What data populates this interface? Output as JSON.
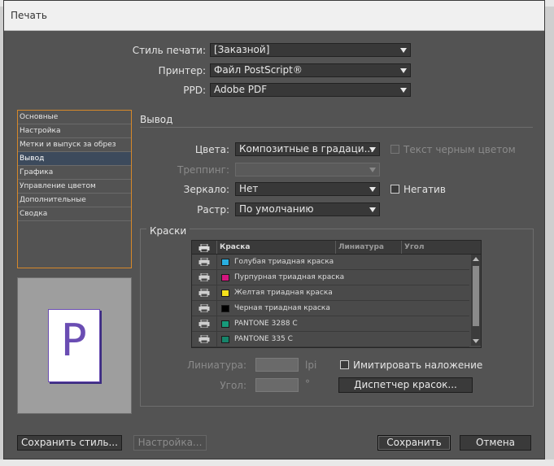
{
  "window": {
    "title": "Печать"
  },
  "top": {
    "style_label": "Стиль печати:",
    "style_value": "[Заказной]",
    "printer_label": "Принтер:",
    "printer_value": "Файл PostScript®",
    "ppd_label": "PPD:",
    "ppd_value": "Adobe PDF"
  },
  "sidebar": {
    "items": [
      {
        "label": "Основные"
      },
      {
        "label": "Настройка"
      },
      {
        "label": "Метки и выпуск за обрез"
      },
      {
        "label": "Вывод"
      },
      {
        "label": "Графика"
      },
      {
        "label": "Управление цветом"
      },
      {
        "label": "Дополнительные"
      },
      {
        "label": "Сводка"
      }
    ],
    "selected": "Вывод"
  },
  "preview": {
    "glyph": "P"
  },
  "output": {
    "section_title": "Вывод",
    "color_label": "Цвета:",
    "color_value": "Композитные в градаци...",
    "text_black_label": "Текст черным цветом",
    "trapping_label": "Треппинг:",
    "trapping_value": "",
    "mirror_label": "Зеркало:",
    "mirror_value": "Нет",
    "negative_label": "Негатив",
    "raster_label": "Растр:",
    "raster_value": "По умолчанию"
  },
  "inks": {
    "section_title": "Краски",
    "columns": [
      "Краска",
      "Линиатура",
      "Угол"
    ],
    "rows": [
      {
        "name": "Голубая триадная краска",
        "color": "#29aee0"
      },
      {
        "name": "Пурпурная триадная краска",
        "color": "#d4157f"
      },
      {
        "name": "Желтая триадная краска",
        "color": "#f5e11c"
      },
      {
        "name": "Черная триадная краска",
        "color": "#000000"
      },
      {
        "name": "PANTONE 3288 C",
        "color": "#179a7a"
      },
      {
        "name": "PANTONE 335 C",
        "color": "#16846a"
      }
    ],
    "frequency_label": "Линиатура:",
    "frequency_unit": "lpi",
    "angle_label": "Угол:",
    "angle_unit": "°",
    "simulate_overprint_label": "Имитировать наложение",
    "ink_manager_label": "Диспетчер красок..."
  },
  "footer": {
    "save_style_label": "Сохранить стиль...",
    "setup_label": "Настройка...",
    "save_label": "Сохранить",
    "cancel_label": "Отмена"
  },
  "colors": {
    "accent": "#d6882a",
    "dialog_bg": "#535353",
    "selection": "#3c4a5c"
  }
}
